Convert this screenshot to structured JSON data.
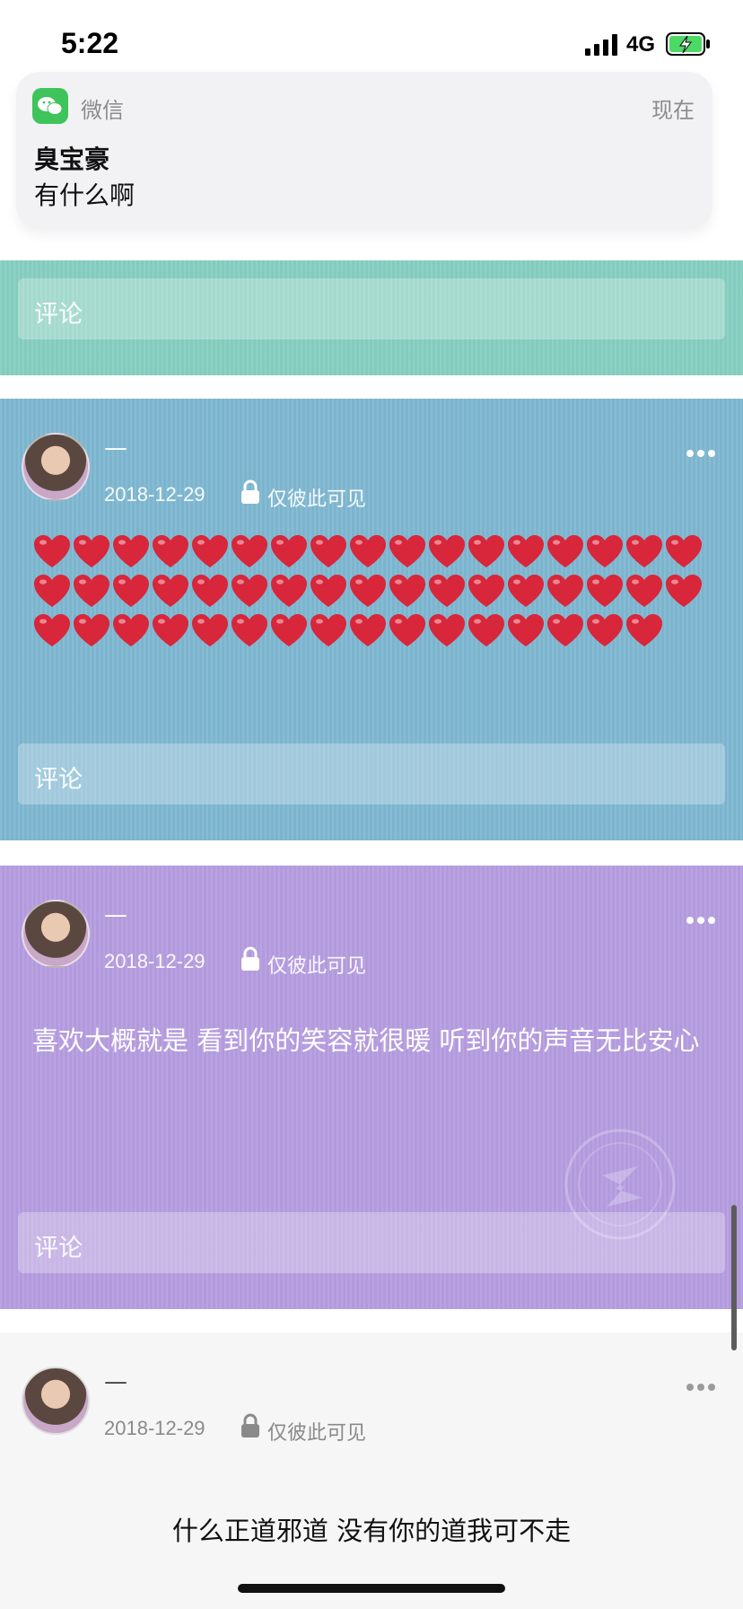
{
  "status_bar": {
    "time": "5:22",
    "network": "4G",
    "battery_charging": true
  },
  "notification": {
    "app_name": "微信",
    "time": "现在",
    "sender": "臭宝豪",
    "message": "有什么啊",
    "app_icon": "wechat-icon"
  },
  "posts": [
    {
      "comment_placeholder": "评论",
      "background": "#86cfc0"
    },
    {
      "name": "—",
      "date": "2018-12-29",
      "privacy": "仅彼此可见",
      "content_type": "hearts",
      "heart_rows": [
        17,
        17,
        16
      ],
      "heart_color": "#d8263a",
      "comment_placeholder": "评论",
      "background": "#7fb8d1"
    },
    {
      "name": "—",
      "date": "2018-12-29",
      "privacy": "仅彼此可见",
      "text": "喜欢大概就是 看到你的笑容就很暖 听到你的声音无比安心",
      "comment_placeholder": "评论",
      "background": "#b69de0"
    },
    {
      "name": "—",
      "date": "2018-12-29",
      "privacy": "仅彼此可见",
      "text": "什么正道邪道 没有你的道我可不走",
      "background": "#f6f6f7"
    }
  ],
  "colors": {
    "wechat_green": "#3ec45a",
    "battery_green": "#4cd964"
  }
}
